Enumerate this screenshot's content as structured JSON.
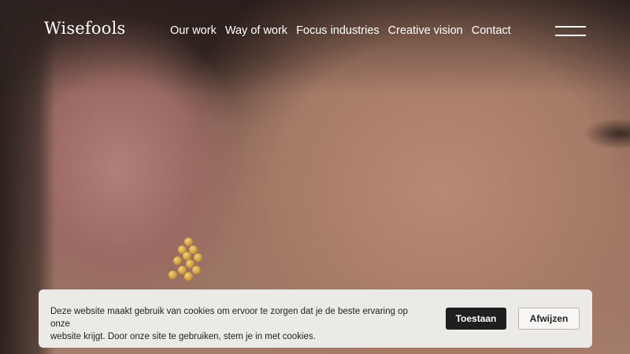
{
  "header": {
    "logo": "Wisefools",
    "nav": [
      {
        "label": "Our work"
      },
      {
        "label": "Way of work"
      },
      {
        "label": "Focus industries"
      },
      {
        "label": "Creative vision"
      },
      {
        "label": "Contact"
      }
    ],
    "menu_icon": "hamburger-menu-icon"
  },
  "cookie_banner": {
    "text_line1": "Deze website maakt gebruik van cookies om ervoor te zorgen dat je de beste ervaring op onze",
    "text_line2": "website krijgt. Door onze site te gebruiken, stem je in met cookies.",
    "accept_label": "Toestaan",
    "reject_label": "Afwijzen"
  },
  "colors": {
    "banner_bg": "#eceae6",
    "accept_bg": "#1f1f1f",
    "nav_text": "#ffffff"
  }
}
